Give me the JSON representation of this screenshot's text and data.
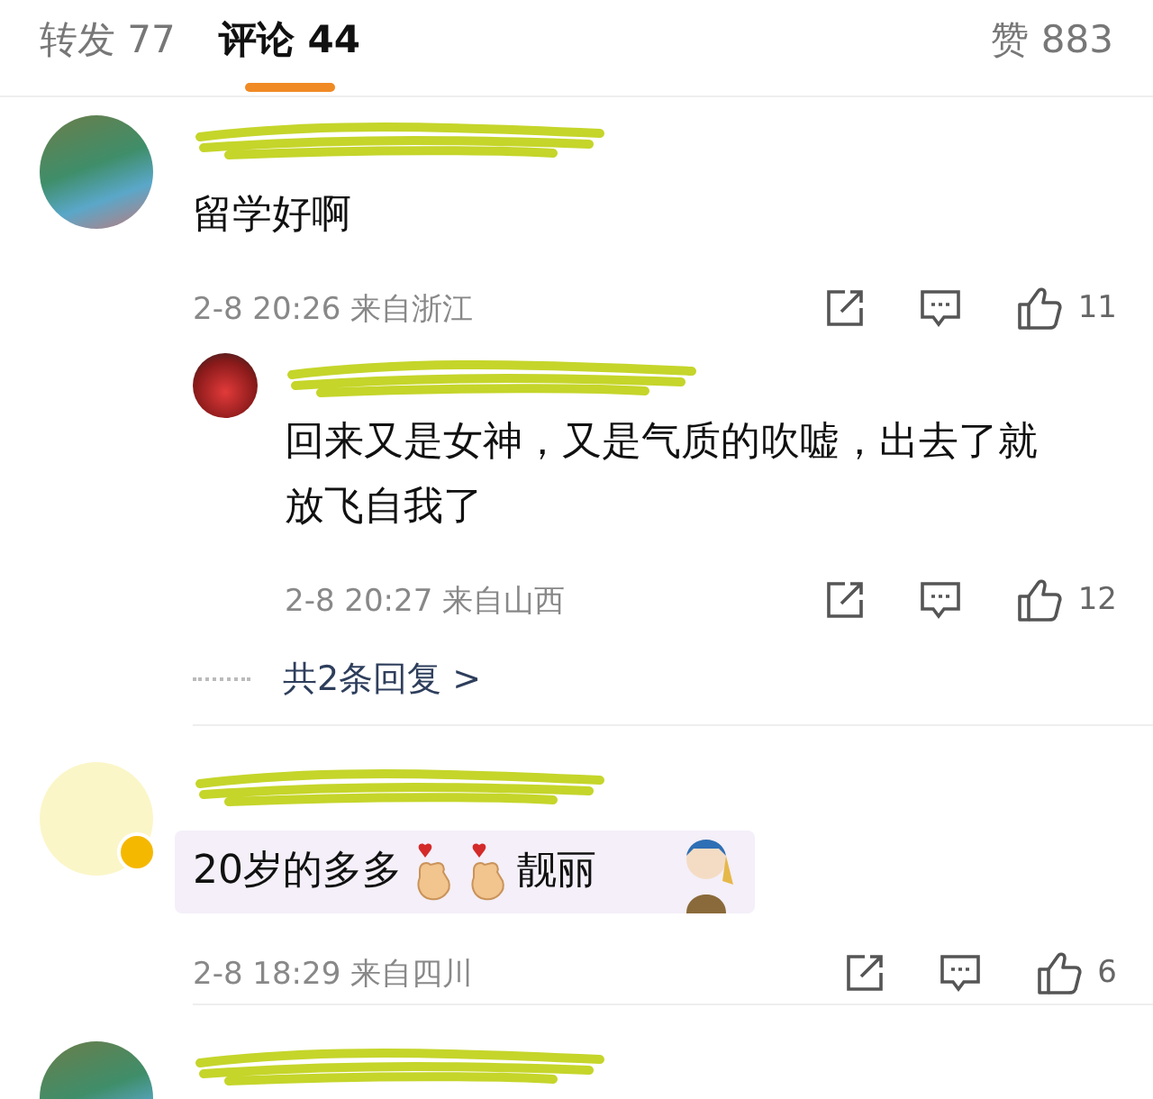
{
  "tabs": [
    {
      "label": "转发 77",
      "selected": false
    },
    {
      "label": "评论 44",
      "selected": true
    }
  ],
  "likes": "赞 883",
  "comments": [
    {
      "kind": "full",
      "avatar": {
        "kind": "photo"
      },
      "verified": false,
      "bubble": false,
      "segments": [
        {
          "kind": "text",
          "text": "留学好啊"
        }
      ],
      "time": "2-8 20:26",
      "location": "来自浙江",
      "likes": "11",
      "replies": [
        {
          "avatar": {
            "kind": "photo"
          },
          "segments": [
            {
              "kind": "text",
              "text": "回来又是女神，又是气质的吹嘘，出去了就放飞自我了"
            }
          ],
          "time": "2-8 20:27",
          "location": "来自山西",
          "likes": "12"
        }
      ],
      "more_replies": "共2条回复 >"
    },
    {
      "kind": "full",
      "avatar": {
        "kind": "cartoon"
      },
      "verified": true,
      "bubble": true,
      "segments": [
        {
          "kind": "text",
          "text": "20岁的多多"
        },
        {
          "kind": "emoji"
        },
        {
          "kind": "emoji"
        },
        {
          "kind": "text",
          "text": "靓丽"
        }
      ],
      "time": "2-8 18:29",
      "location": "来自四川",
      "likes": "6"
    },
    {
      "kind": "cut",
      "avatar": {
        "kind": "photo"
      }
    }
  ]
}
